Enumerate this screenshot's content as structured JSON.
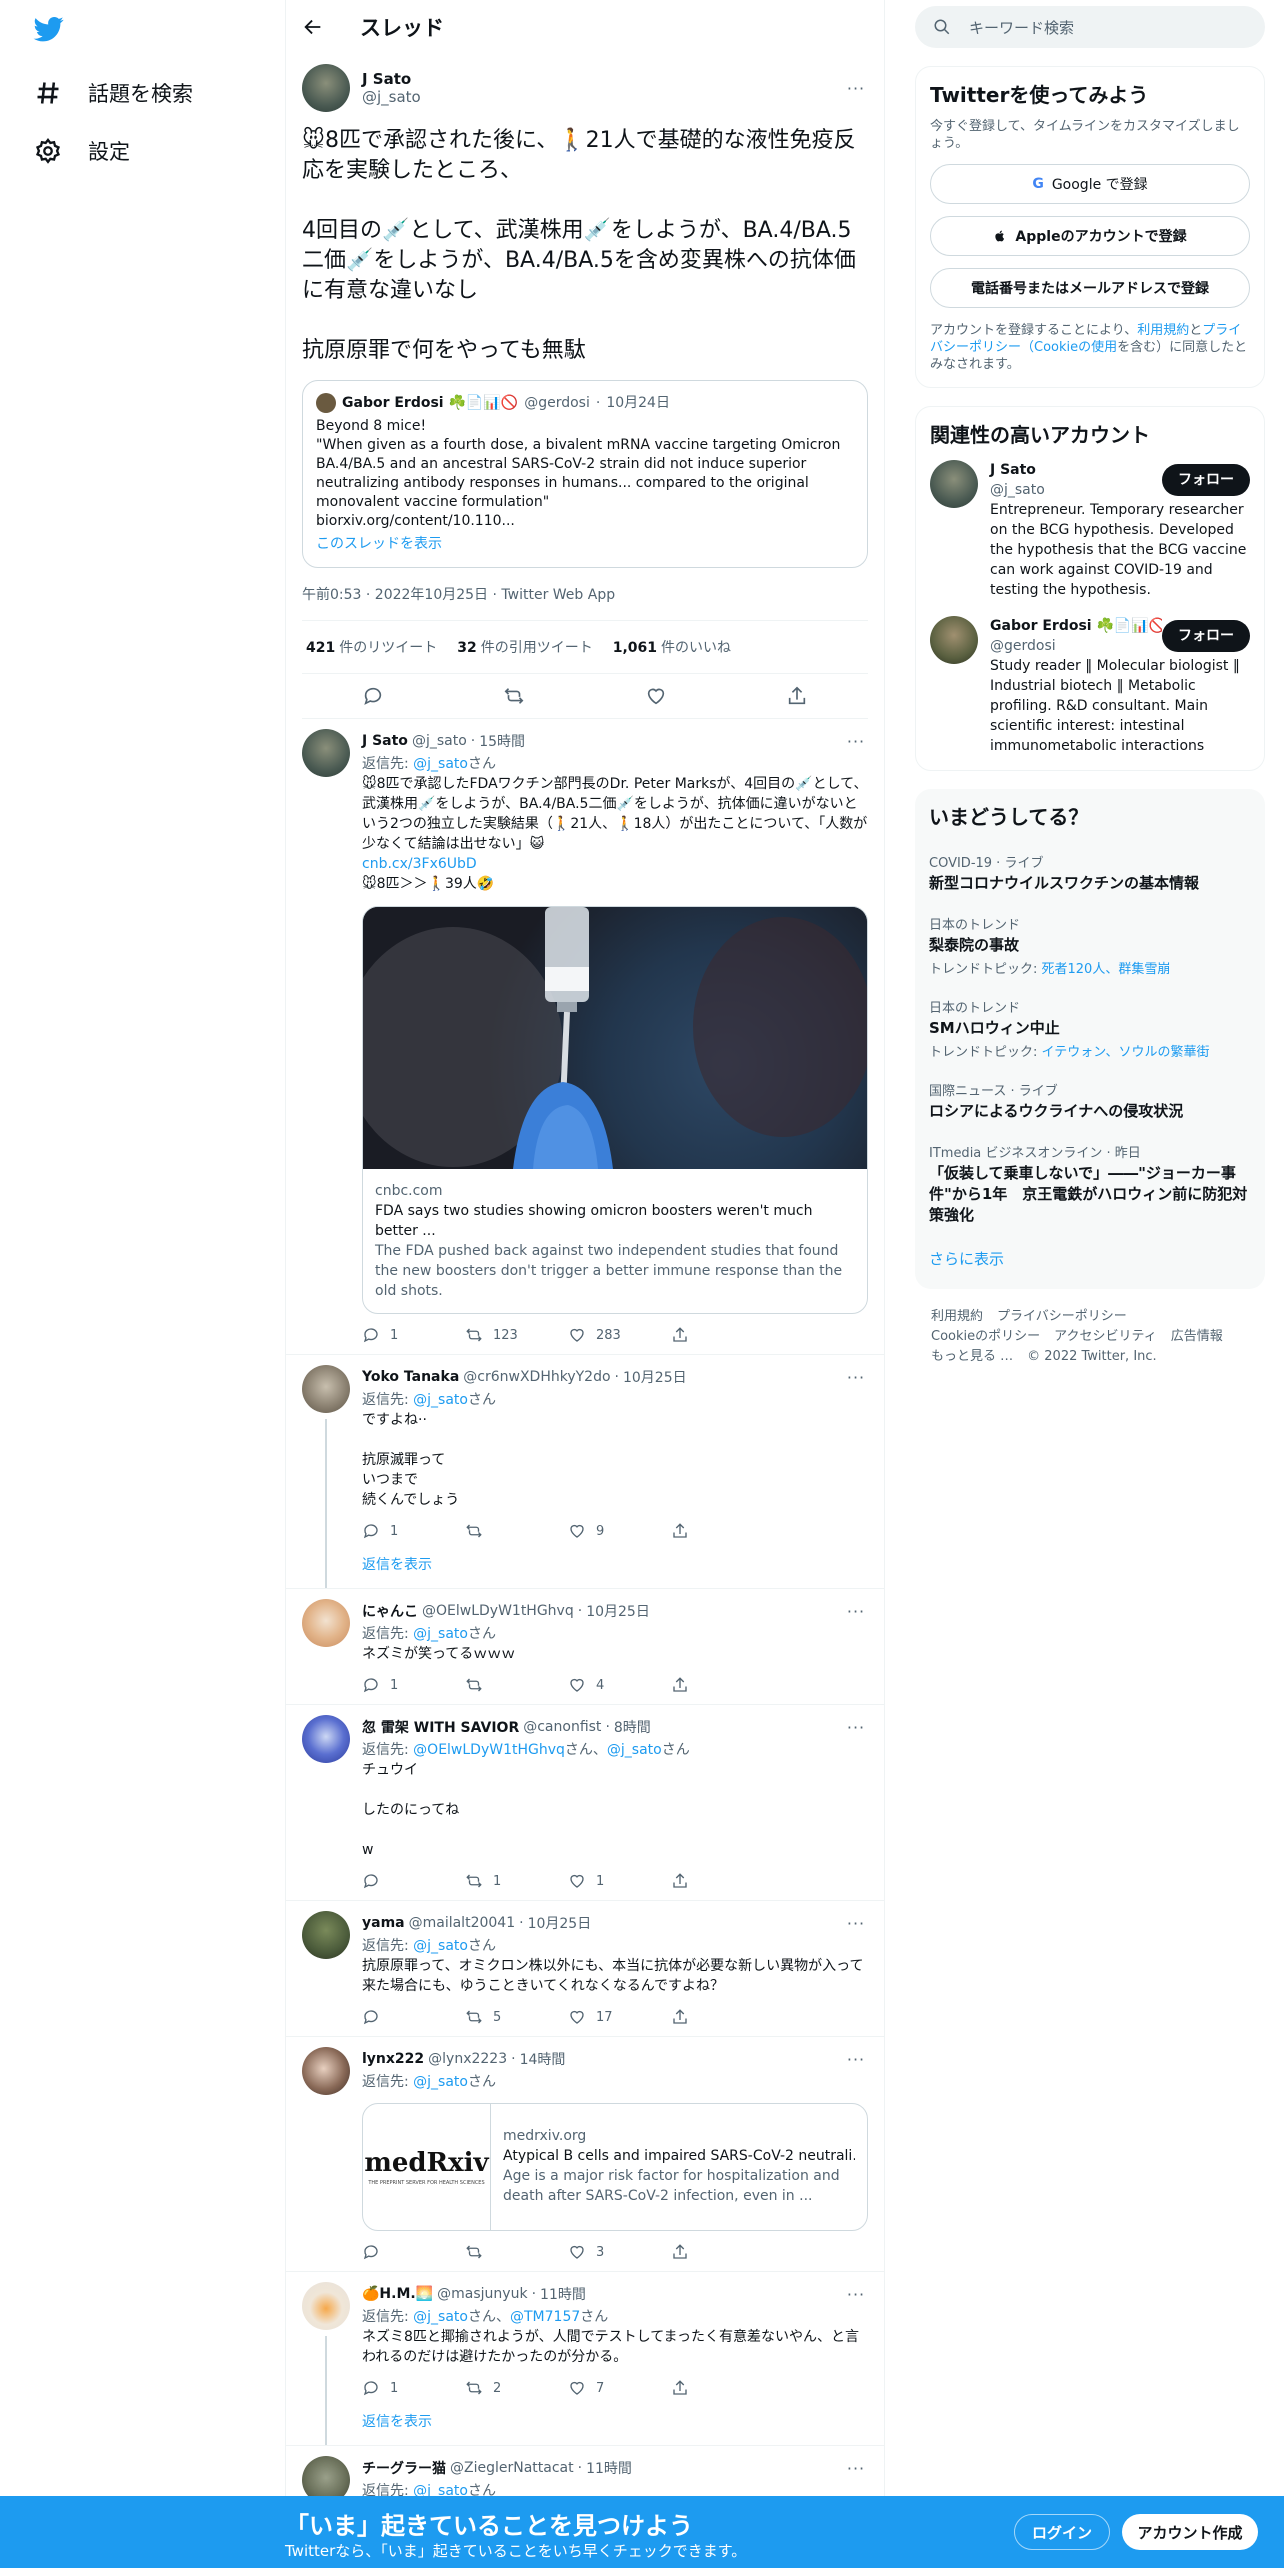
{
  "nav": {
    "items": [
      {
        "label": "話題を検索",
        "icon": "hashtag-icon"
      },
      {
        "label": "設定",
        "icon": "gear-icon"
      }
    ]
  },
  "header": {
    "title": "スレッド"
  },
  "focal": {
    "name": "J Sato",
    "handle": "@j_sato",
    "text": "🐭8匹で承認された後に、🚶21人で基礎的な液性免疫反応を実験したところ、\n\n4回目の💉として、武漢株用💉をしようが、BA.4/BA.5二価💉をしようが、BA.4/BA.5を含め変異株への抗体価に有意な違いなし\n\n抗原原罪で何をやっても無駄",
    "quote": {
      "name": "Gabor Erdosi ☘️📄📊🚫",
      "handle": "@gerdosi",
      "date": "10月24日",
      "text": "Beyond 8 mice!\n\"When given as a fourth dose, a bivalent mRNA vaccine targeting Omicron BA.4/BA.5 and an ancestral SARS-CoV-2 strain did not induce superior neutralizing antibody responses in humans... compared to the original monovalent vaccine formulation\"\nbiorxiv.org/content/10.110...",
      "link": "このスレッドを表示"
    },
    "meta": "午前0:53 · 2022年10月25日 · Twitter Web App",
    "retweets": "421",
    "retweets_label": "件のリツイート",
    "quotes": "32",
    "quotes_label": "件の引用ツイート",
    "likes": "1,061",
    "likes_label": "件のいいね"
  },
  "replies": [
    {
      "name": "J Sato",
      "handle": "@j_sato",
      "time": "15時間",
      "reply_to": "@j_sato",
      "reply_suffix": "さん",
      "text_pre": "🐭8匹で承認したFDAワクチン部門長のDr. Peter Marksが、4回目の💉として、武漢株用💉をしようが、BA.4/BA.5二価💉をしようが、抗体価に違いがないという2つの独立した実験結果（🚶21人、🚶18人）が出たことについて、「人数が少なくて結論は出せない」😺",
      "link": "cnb.cx/3Fx6UbD",
      "text_post": "🐭8匹＞＞🚶39人🤣",
      "card": {
        "domain": "cnbc.com",
        "title": "FDA says two studies showing omicron boosters weren't much better ...",
        "desc": "The FDA pushed back against two independent studies that found the new boosters don't trigger a better immune response than the old shots."
      },
      "reply_count": "1",
      "rt": "123",
      "like": "283"
    },
    {
      "name": "Yoko Tanaka",
      "handle": "@cr6nwXDHhkyY2do",
      "time": "10月25日",
      "reply_to": "@j_sato",
      "reply_suffix": "さん",
      "text": "ですよね··\n\n抗原滅罪って\nいつまで\n続くんでしょう",
      "reply_count": "1",
      "rt": "",
      "like": "9",
      "show": "返信を表示"
    },
    {
      "name": "にゃんこ",
      "handle": "@OElwLDyW1tHGhvq",
      "time": "10月25日",
      "reply_to": "@j_sato",
      "reply_suffix": "さん",
      "text": "ネズミが笑ってるｗｗｗ",
      "reply_count": "1",
      "rt": "",
      "like": "4"
    },
    {
      "name": "忽 雷架 WITH SAVIOR",
      "handle": "@canonfist",
      "time": "8時間",
      "reply_to": "@OElwLDyW1tHGhvq",
      "reply_to2": "@j_sato",
      "reply_suffix": "さん",
      "text": "チュウイ\n\nしたのにってね\n\nw",
      "reply_count": "",
      "rt": "1",
      "like": "1"
    },
    {
      "name": "yama",
      "handle": "@mailalt20041",
      "time": "10月25日",
      "reply_to": "@j_sato",
      "reply_suffix": "さん",
      "text": "抗原原罪って、オミクロン株以外にも、本当に抗体が必要な新しい異物が入って来た場合にも、ゆうこときいてくれなくなるんですよね？",
      "reply_count": "",
      "rt": "5",
      "like": "17"
    },
    {
      "name": "lynx222",
      "handle": "@lynx2223",
      "time": "14時間",
      "reply_to": "@j_sato",
      "reply_suffix": "さん",
      "card": {
        "domain": "medrxiv.org",
        "title": "Atypical B cells and impaired SARS-CoV-2 neutrali...",
        "desc": "Age is a major risk factor for hospitalization and death after SARS-CoV-2 infection, even in ...",
        "logo": "medRxiv",
        "logo_sub": "THE PREPRINT SERVER FOR HEALTH SCIENCES"
      },
      "reply_count": "",
      "rt": "",
      "like": "3"
    },
    {
      "name": "🍊H.M.🌅",
      "handle": "@masjunyuk",
      "time": "11時間",
      "reply_to": "@j_sato",
      "reply_to2": "@TM7157",
      "reply_suffix": "さん",
      "text": "ネズミ8匹と揶揄されようが、人間でテストしてまったく有意差ないやん、と言われるのだけは避けたかったのが分かる。",
      "reply_count": "1",
      "rt": "2",
      "like": "7",
      "show": "返信を表示"
    },
    {
      "name": "チーグラー猫",
      "handle": "@ZieglerNattacat",
      "time": "11時間",
      "reply_to": "@j_sato",
      "reply_suffix": "さん"
    }
  ],
  "search": {
    "placeholder": "キーワード検索"
  },
  "signup": {
    "title": "Twitterを使ってみよう",
    "sub": "今すぐ登録して、タイムラインをカスタマイズしましょう。",
    "google": "Google で登録",
    "apple": "Appleのアカウントで登録",
    "phone": "電話番号またはメールアドレスで登録",
    "legal_pre": "アカウントを登録することにより、",
    "legal_tos": "利用規約",
    "legal_and": "と",
    "legal_pp": "プライバシーポリシー（Cookieの使用",
    "legal_post": "を含む）に同意したとみなされます。"
  },
  "related": {
    "title": "関連性の高いアカウント",
    "accounts": [
      {
        "name": "J Sato",
        "handle": "@j_sato",
        "bio": "Entrepreneur. Temporary researcher on the BCG hypothesis. Developed the hypothesis that the BCG vaccine can work against COVID-19 and testing the hypothesis.",
        "follow": "フォロー"
      },
      {
        "name": "Gabor Erdosi ☘️📄📊🚫",
        "handle": "@gerdosi",
        "bio": "Study reader ‖ Molecular biologist ‖ Industrial biotech ‖ Metabolic profiling. R&D consultant. Main scientific interest: intestinal immunometabolic interactions",
        "follow": "フォロー"
      }
    ]
  },
  "trends": {
    "title": "いまどうしてる？",
    "items": [
      {
        "cat": "COVID-19 · ライブ",
        "name": "新型コロナウイルスワクチンの基本情報",
        "sub": ""
      },
      {
        "cat": "日本のトレンド",
        "name": "梨泰院の事故",
        "sub_label": "トレンドトピック: ",
        "sub": "死者120人、群集雪崩"
      },
      {
        "cat": "日本のトレンド",
        "name": "SMハロウィン中止",
        "sub_label": "トレンドトピック: ",
        "sub": "イテウォン、ソウルの繁華街"
      },
      {
        "cat": "国際ニュース · ライブ",
        "name": "ロシアによるウクライナへの侵攻状況",
        "sub": ""
      },
      {
        "cat": "ITmedia ビジネスオンライン · 昨日",
        "name": "「仮装して乗車しないで」――\"ジョーカー事件\"から1年　京王電鉄がハロウィン前に防犯対策強化",
        "sub": ""
      }
    ],
    "more": "さらに表示"
  },
  "footer": {
    "links": [
      "利用規約",
      "プライバシーポリシー",
      "Cookieのポリシー",
      "アクセシビリティ",
      "広告情報",
      "もっと見る …"
    ],
    "copy": "© 2022 Twitter, Inc."
  },
  "bottom": {
    "title": "「いま」起きていることを見つけよう",
    "sub": "Twitterなら、「いま」起きていることをいち早くチェックできます。",
    "login": "ログイン",
    "signup": "アカウント作成"
  },
  "colors": {
    "accent": "#1d9bf0",
    "text": "#0f1419",
    "muted": "#536471"
  }
}
